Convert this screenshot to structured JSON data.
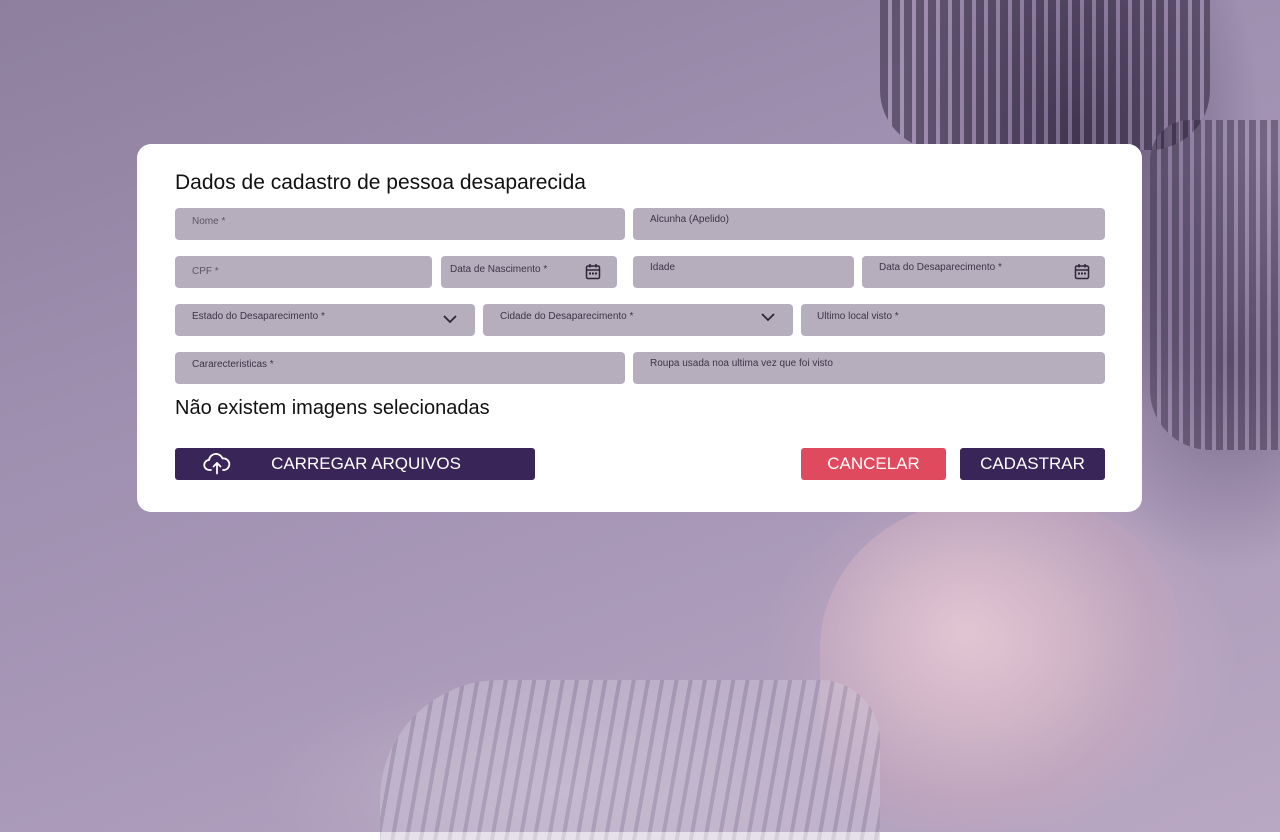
{
  "form": {
    "title": "Dados de cadastro de pessoa desaparecida",
    "fields": {
      "nome": "Nome *",
      "alcunha": "Alcunha (Apelido)",
      "cpf": "CPF *",
      "data_nascimento": "Data de Nascimento *",
      "idade": "Idade",
      "data_desaparecimento": "Data do Desaparecimento *",
      "estado_desaparecimento": "Estado do Desaparecimento *",
      "cidade_desaparecimento": "Cidade do Desaparecimento *",
      "ultimo_local": "Ultimo local visto *",
      "caracteristicas": "Cararecteristicas *",
      "roupa": "Roupa usada noa ultima vez que foi visto"
    },
    "images_empty_message": "Não existem imagens selecionadas",
    "buttons": {
      "upload": "CARREGAR ARQUIVOS",
      "cancel": "CANCELAR",
      "submit": "CADASTRAR"
    },
    "icons": {
      "calendar": "calendar-icon",
      "dropdown": "chevron-down-icon",
      "upload": "cloud-upload-icon"
    }
  },
  "colors": {
    "field_bg": "#b6aebd",
    "primary": "#3a2558",
    "danger": "#e04a5e",
    "overlay": "#9f8fb0"
  }
}
